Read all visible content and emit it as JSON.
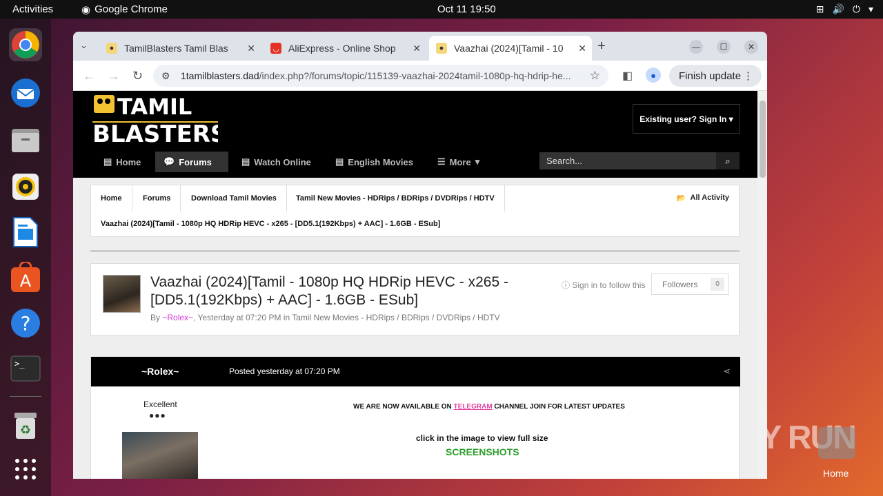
{
  "system": {
    "activities": "Activities",
    "app_name": "Google Chrome",
    "clock": "Oct 11  19:50"
  },
  "browser": {
    "tabs": [
      {
        "title": "TamilBlasters Tamil Blas"
      },
      {
        "title": "AliExpress - Online Shop"
      },
      {
        "title": "Vaazhai (2024)[Tamil - 10"
      }
    ],
    "url_host": "1tamilblasters.dad",
    "url_path": "/index.php?/forums/topic/115139-vaazhai-2024tamil-1080p-hq-hdrip-he...",
    "finish_update": "Finish update"
  },
  "site": {
    "logo_line1": "TAMIL",
    "logo_line2": "BLASTERS",
    "signin": "Existing user? Sign In",
    "nav": [
      "Home",
      "Forums",
      "Watch Online",
      "English Movies",
      "More"
    ],
    "search_placeholder": "Search...",
    "breadcrumbs": [
      "Home",
      "Forums",
      "Download Tamil Movies",
      "Tamil New Movies - HDRips / BDRips / DVDRips / HDTV"
    ],
    "breadcrumb_current": "Vaazhai (2024)[Tamil - 1080p HQ HDRip HEVC - x265 - [DD5.1(192Kbps) + AAC] - 1.6GB - ESub]",
    "all_activity": "All Activity"
  },
  "topic": {
    "title": "Vaazhai (2024)[Tamil - 1080p HQ HDRip HEVC - x265 - [DD5.1(192Kbps) + AAC] - 1.6GB - ESub]",
    "by": "By ",
    "author": "~Rolex~",
    "meta_rest": ", Yesterday at 07:20 PM in Tamil New Movies - HDRips / BDRips / DVDRips / HDTV",
    "follow": "Sign in to follow this",
    "followers_label": "Followers",
    "followers_count": "0"
  },
  "post": {
    "author": "~Rolex~",
    "posted": "Posted yesterday at 07:20 PM",
    "rank": "Excellent",
    "pips": "●●●",
    "line1_pre": "WE ARE NOW AVAILABLE ON ",
    "line1_link": "TELEGRAM",
    "line1_post": " CHANNEL JOIN FOR LATEST UPDATES",
    "line2": "click in the image to view full size",
    "line3": "SCREENSHOTS"
  },
  "desktop": {
    "watermark": "ANY RUN",
    "home_label": "Home"
  }
}
